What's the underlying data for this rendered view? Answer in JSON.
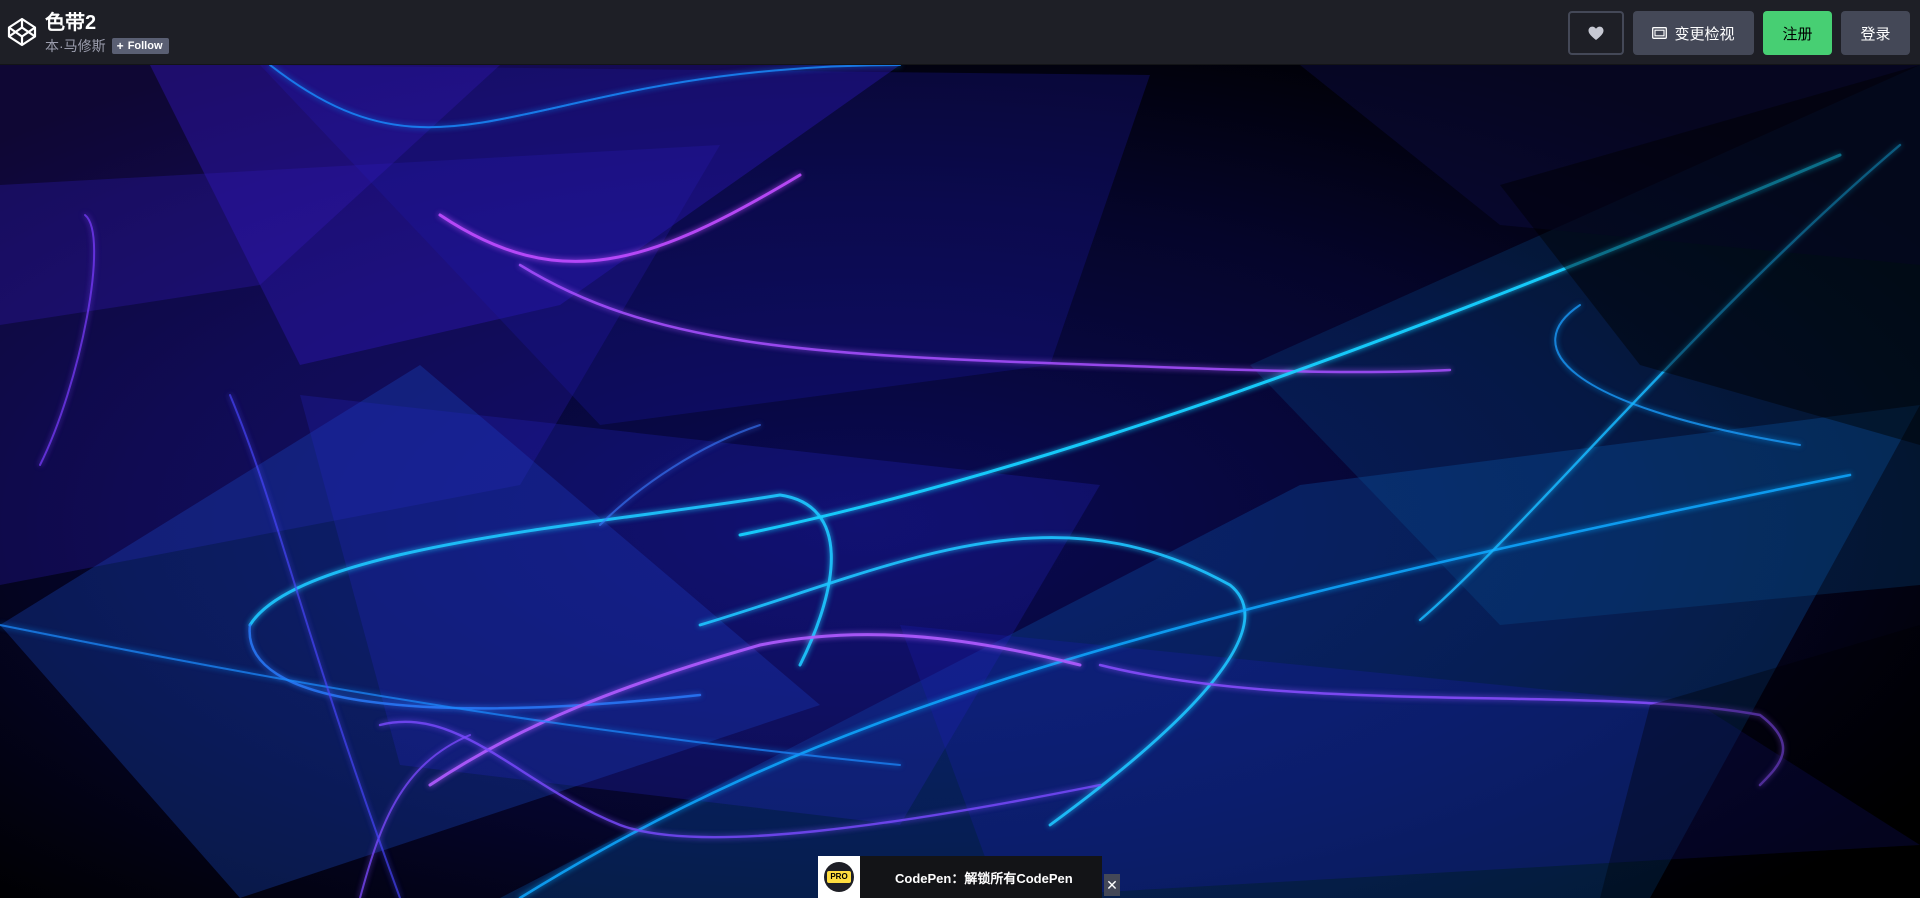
{
  "header": {
    "pen_title": "色带2",
    "author": "本·马修斯",
    "follow_label": "Follow",
    "view_button_label": "变更检视",
    "signup_label": "注册",
    "login_label": "登录"
  },
  "promo": {
    "badge_text": "PRO",
    "text": "CodePen：解锁所有CodePen",
    "close_label": "✕"
  },
  "colors": {
    "header_bg": "#1e1f26",
    "button_bg": "#444857",
    "signup_green": "#47cf73",
    "ribbon_cyan": "#00c8ff",
    "ribbon_violet": "#9a3cff",
    "ribbon_blue": "#2d2ddc"
  },
  "icons": {
    "logo": "codepen-logo-icon",
    "heart": "heart-icon",
    "view": "view-change-icon",
    "close": "close-icon"
  }
}
